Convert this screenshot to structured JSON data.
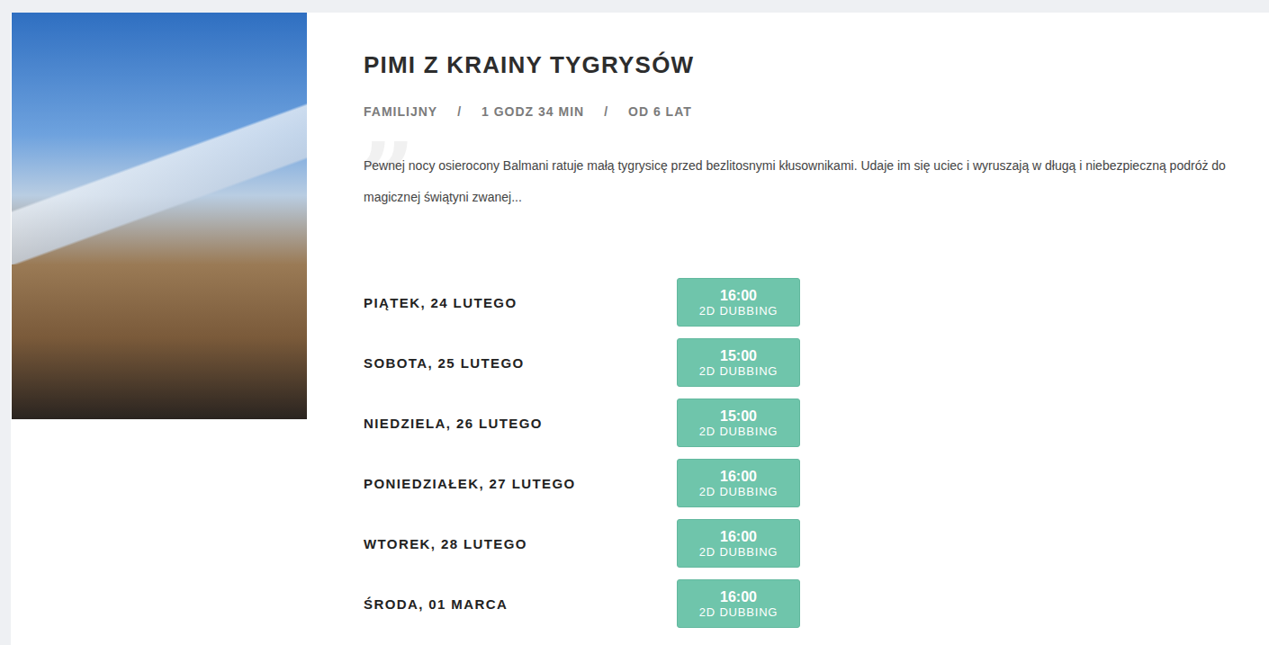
{
  "movie": {
    "title": "PIMI Z KRAINY TYGRYSÓW",
    "meta": [
      "FAMILIJNY",
      "1 GODZ 34 MIN",
      "OD 6 LAT"
    ],
    "separator": "/",
    "quote_mark": "”",
    "description": "Pewnej nocy osierocony Balmani ratuje małą tygrysicę przed bezlitosnymi kłusownikami. Udaje im się uciec i wyruszają w długą i niebezpieczną podróż do magicznej świątyni zwanej..."
  },
  "showings": [
    {
      "day": "PIĄTEK, 24 LUTEGO",
      "time": "16:00",
      "format": "2D DUBBING"
    },
    {
      "day": "SOBOTA, 25 LUTEGO",
      "time": "15:00",
      "format": "2D DUBBING"
    },
    {
      "day": "NIEDZIELA, 26 LUTEGO",
      "time": "15:00",
      "format": "2D DUBBING"
    },
    {
      "day": "PONIEDZIAŁEK, 27 LUTEGO",
      "time": "16:00",
      "format": "2D DUBBING"
    },
    {
      "day": "WTOREK, 28 LUTEGO",
      "time": "16:00",
      "format": "2D DUBBING"
    },
    {
      "day": "ŚRODA, 01 MARCA",
      "time": "16:00",
      "format": "2D DUBBING"
    }
  ]
}
